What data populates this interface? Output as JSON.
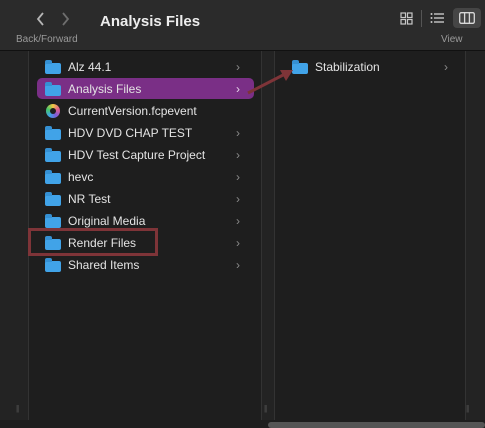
{
  "window": {
    "title": "Analysis Files"
  },
  "toolbar": {
    "back_icon": "chevron-left-icon",
    "forward_icon": "chevron-right-icon",
    "back_forward_label": "Back/Forward",
    "view_label": "View",
    "view_modes": [
      "icon-grid",
      "list",
      "columns"
    ],
    "active_view": "columns"
  },
  "column1": {
    "items": [
      {
        "label": "Alz 44.1",
        "icon": "folder-icon",
        "has_children": true
      },
      {
        "label": "Analysis Files",
        "icon": "folder-icon",
        "has_children": true,
        "selected": true
      },
      {
        "label": "CurrentVersion.fcpevent",
        "icon": "fcpevent-file-icon",
        "has_children": false
      },
      {
        "label": "HDV DVD CHAP TEST",
        "icon": "folder-icon",
        "has_children": true
      },
      {
        "label": "HDV Test Capture Project",
        "icon": "folder-icon",
        "has_children": true
      },
      {
        "label": "hevc",
        "icon": "folder-icon",
        "has_children": true
      },
      {
        "label": "NR Test",
        "icon": "folder-icon",
        "has_children": true
      },
      {
        "label": "Original Media",
        "icon": "folder-icon",
        "has_children": true
      },
      {
        "label": "Render Files",
        "icon": "folder-icon",
        "has_children": true,
        "highlighted": true
      },
      {
        "label": "Shared Items",
        "icon": "folder-icon",
        "has_children": true
      }
    ]
  },
  "column2": {
    "items": [
      {
        "label": "Stabilization",
        "icon": "folder-icon",
        "has_children": true
      }
    ]
  },
  "colors": {
    "selection": "#7a2f86",
    "annotation": "#7e3438",
    "folder": "#41a3e8",
    "background": "#1e1e1e"
  }
}
